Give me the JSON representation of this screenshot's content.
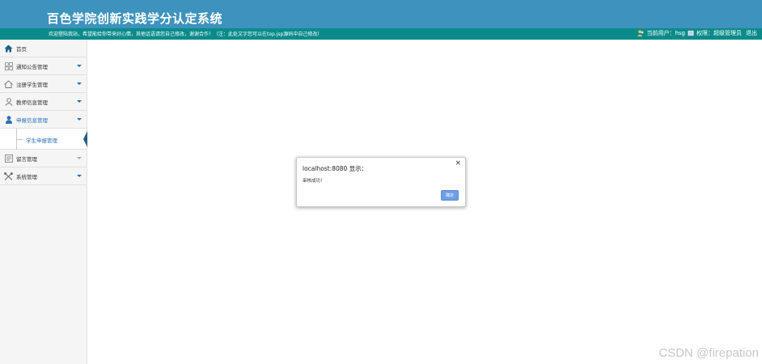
{
  "header": {
    "title": "百色学院创新实践学分认定系统",
    "welcome": "欢迎登陆我站，希望能给你带来好心情，其他话语请您自己修改，谢谢合作！（注：此处文字您可以在top.jsp源码中自己修改）",
    "current_user": "当前用户：hsg",
    "permission": "权限：超级管理员",
    "logout": "退出"
  },
  "sidebar": {
    "items": [
      {
        "label": "首页",
        "icon": "home-icon"
      },
      {
        "label": "通知公告管理",
        "icon": "grid-icon"
      },
      {
        "label": "注册学生管理",
        "icon": "house-icon"
      },
      {
        "label": "教师信息管理",
        "icon": "person-outline-icon"
      },
      {
        "label": "申报信息管理",
        "icon": "person-solid-icon"
      },
      {
        "label": "留言管理",
        "icon": "message-board-icon"
      },
      {
        "label": "系统管理",
        "icon": "tools-icon"
      }
    ],
    "submenu": {
      "label": "学生申报管理"
    }
  },
  "dialog": {
    "title": "localhost:8080 显示：",
    "message": "审核成功！",
    "ok_label": "确定",
    "close": "×"
  },
  "watermark": "CSDN @firepation",
  "colors": {
    "header_bg": "#3d93bd",
    "info_bar_bg": "#0a8b8b",
    "active_blue": "#2a6fb6",
    "ok_button": "#6d9fe6"
  }
}
